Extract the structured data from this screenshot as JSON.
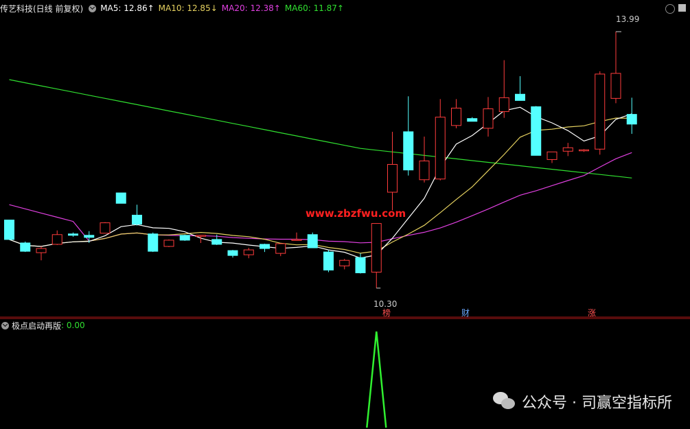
{
  "header": {
    "stock_title": "传艺科技(日线 前复权)",
    "ma5": "MA5: 12.86↑",
    "ma10": "MA10: 12.85↓",
    "ma20": "MA20: 12.38↑",
    "ma60": "MA60: 11.87↑"
  },
  "colors": {
    "up": "#ff3c3c",
    "down": "#54ffff",
    "ma5": "#ffffff",
    "ma10": "#e6d260",
    "ma20": "#e040e0",
    "ma60": "#30e030",
    "indicator": "#30f030"
  },
  "chart": {
    "max_label": "13.99",
    "min_label": "10.30",
    "markers": [
      {
        "label": "榜",
        "color": "#ff5050"
      },
      {
        "label": "财",
        "color": "#6aa8ff"
      },
      {
        "label": "涨",
        "color": "#ff5050"
      }
    ],
    "watermark": "www.zbzfwu.com"
  },
  "indicator": {
    "name": "极点启动再版",
    "value": ": 0.00"
  },
  "footer": {
    "wechat_label": "公众号 · 司赢空指标所"
  },
  "chart_data": {
    "type": "candlestick",
    "series": [
      {
        "name": "MA5"
      },
      {
        "name": "MA10"
      },
      {
        "name": "MA20"
      },
      {
        "name": "MA60"
      }
    ],
    "candles": [
      {
        "o": 11.28,
        "h": 11.28,
        "l": 11.0,
        "c": 11.0
      },
      {
        "o": 10.95,
        "h": 10.97,
        "l": 10.82,
        "c": 10.83
      },
      {
        "o": 10.81,
        "h": 10.9,
        "l": 10.7,
        "c": 10.87
      },
      {
        "o": 10.93,
        "h": 11.13,
        "l": 10.92,
        "c": 11.07
      },
      {
        "o": 11.08,
        "h": 11.1,
        "l": 11.04,
        "c": 11.06
      },
      {
        "o": 11.06,
        "h": 11.12,
        "l": 10.95,
        "c": 11.03
      },
      {
        "o": 11.09,
        "h": 11.25,
        "l": 11.09,
        "c": 11.24
      },
      {
        "o": 11.67,
        "h": 11.67,
        "l": 11.52,
        "c": 11.52
      },
      {
        "o": 11.35,
        "h": 11.5,
        "l": 11.2,
        "c": 11.22
      },
      {
        "o": 11.08,
        "h": 11.1,
        "l": 10.82,
        "c": 10.83
      },
      {
        "o": 10.9,
        "h": 11.0,
        "l": 10.89,
        "c": 10.99
      },
      {
        "o": 11.06,
        "h": 11.07,
        "l": 10.98,
        "c": 10.99
      },
      {
        "o": 11.06,
        "h": 11.06,
        "l": 10.95,
        "c": 11.06
      },
      {
        "o": 11.0,
        "h": 11.07,
        "l": 10.92,
        "c": 10.93
      },
      {
        "o": 10.84,
        "h": 10.85,
        "l": 10.74,
        "c": 10.77
      },
      {
        "o": 10.78,
        "h": 10.88,
        "l": 10.73,
        "c": 10.85
      },
      {
        "o": 10.93,
        "h": 10.94,
        "l": 10.82,
        "c": 10.87
      },
      {
        "o": 10.8,
        "h": 10.94,
        "l": 10.76,
        "c": 10.94
      },
      {
        "o": 11.0,
        "h": 11.1,
        "l": 11.0,
        "c": 11.0
      },
      {
        "o": 11.07,
        "h": 11.1,
        "l": 10.93,
        "c": 10.88
      },
      {
        "o": 10.82,
        "h": 10.85,
        "l": 10.53,
        "c": 10.56
      },
      {
        "o": 10.62,
        "h": 10.72,
        "l": 10.57,
        "c": 10.7
      },
      {
        "o": 10.74,
        "h": 10.8,
        "l": 10.51,
        "c": 10.52
      },
      {
        "o": 10.53,
        "h": 11.23,
        "l": 10.3,
        "c": 11.23
      },
      {
        "o": 11.68,
        "h": 12.55,
        "l": 11.42,
        "c": 12.08
      },
      {
        "o": 12.55,
        "h": 13.06,
        "l": 11.92,
        "c": 12.0
      },
      {
        "o": 11.86,
        "h": 12.48,
        "l": 11.82,
        "c": 12.13
      },
      {
        "o": 11.87,
        "h": 13.02,
        "l": 11.85,
        "c": 12.76
      },
      {
        "o": 12.64,
        "h": 13.02,
        "l": 12.6,
        "c": 12.89
      },
      {
        "o": 12.74,
        "h": 12.76,
        "l": 12.7,
        "c": 12.7
      },
      {
        "o": 12.6,
        "h": 13.05,
        "l": 12.48,
        "c": 12.88
      },
      {
        "o": 12.84,
        "h": 13.58,
        "l": 12.75,
        "c": 13.04
      },
      {
        "o": 13.09,
        "h": 13.35,
        "l": 13.0,
        "c": 13.0
      },
      {
        "o": 12.91,
        "h": 12.92,
        "l": 12.21,
        "c": 12.21
      },
      {
        "o": 12.15,
        "h": 12.26,
        "l": 12.1,
        "c": 12.26
      },
      {
        "o": 12.27,
        "h": 12.39,
        "l": 12.2,
        "c": 12.32
      },
      {
        "o": 12.29,
        "h": 12.3,
        "l": 12.26,
        "c": 12.29
      },
      {
        "o": 12.3,
        "h": 13.42,
        "l": 12.22,
        "c": 13.38
      },
      {
        "o": 13.03,
        "h": 13.99,
        "l": 12.96,
        "c": 13.39
      },
      {
        "o": 12.8,
        "h": 13.04,
        "l": 12.52,
        "c": 12.66
      }
    ],
    "ylim": [
      10.1,
      14.1
    ],
    "indicator_values": [
      0,
      0,
      0,
      0,
      0,
      0,
      0,
      0,
      0,
      0,
      0,
      0,
      0,
      0,
      0,
      0,
      0,
      0,
      0,
      0,
      0,
      0,
      0,
      1,
      0,
      0,
      0,
      0,
      0,
      0,
      0,
      0,
      0,
      0,
      0,
      0,
      0,
      0,
      0,
      0
    ]
  }
}
